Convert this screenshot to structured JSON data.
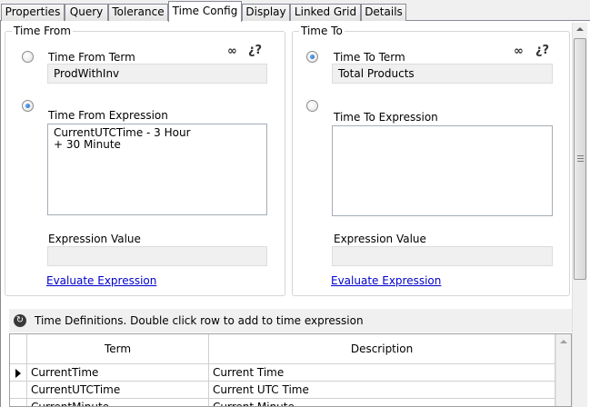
{
  "tabs": [
    {
      "label": "Properties",
      "active": false
    },
    {
      "label": "Query",
      "active": false
    },
    {
      "label": "Tolerance",
      "active": false
    },
    {
      "label": "Time Config",
      "active": true
    },
    {
      "label": "Display",
      "active": false
    },
    {
      "label": "Linked Grid",
      "active": false
    },
    {
      "label": "Details",
      "active": false
    }
  ],
  "time_from": {
    "group_label": "Time From",
    "term_label": "Time From Term",
    "term_value": "ProdWithInv",
    "term_selected": false,
    "expression_label": "Time From Expression",
    "expression_value": "CurrentUTCTime - 3 Hour\n+ 30 Minute",
    "expression_selected": true,
    "expr_value_label": "Expression Value",
    "expr_value": "",
    "evaluate_link": "Evaluate Expression"
  },
  "time_to": {
    "group_label": "Time To",
    "term_label": "Time To Term",
    "term_value": "Total Products",
    "term_selected": true,
    "expression_label": "Time To Expression",
    "expression_value": "",
    "expression_selected": false,
    "expr_value_label": "Expression Value",
    "expr_value": "",
    "evaluate_link": "Evaluate Expression"
  },
  "icons": {
    "link_icon": "link-icon",
    "unlink_icon": "unlink-icon",
    "refresh_icon": "refresh-icon"
  },
  "definitions": {
    "caption": "Time Definitions.   Double click row to add to time expression",
    "columns": [
      "Term",
      "Description"
    ],
    "rows": [
      {
        "term": "CurrentTime",
        "description": "Current Time"
      },
      {
        "term": "CurrentUTCTime",
        "description": "Current UTC Time"
      },
      {
        "term": "CurrentMinute",
        "description": "Current Minute"
      }
    ]
  }
}
